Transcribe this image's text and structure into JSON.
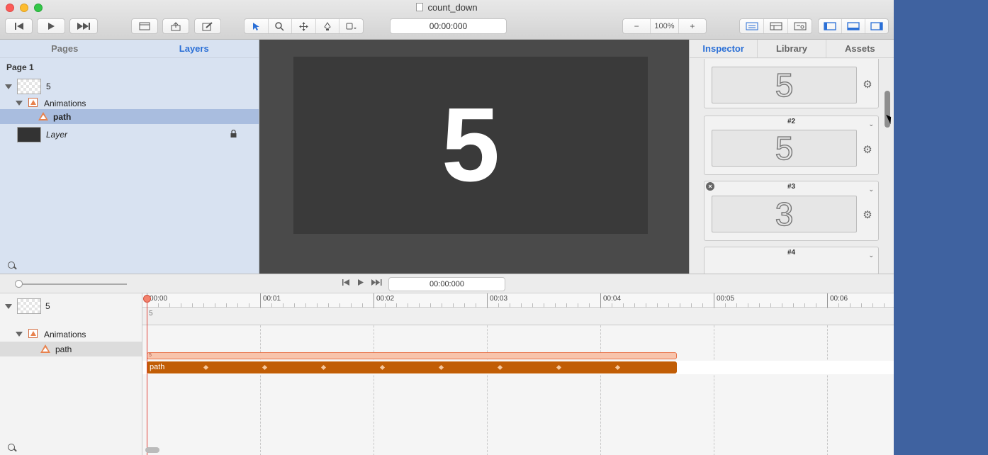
{
  "window": {
    "title": "count_down"
  },
  "toolbar": {
    "time": "00:00:000",
    "zoom": "100%",
    "zoom_minus": "−",
    "zoom_plus": "+"
  },
  "left_panel": {
    "tabs": [
      "Pages",
      "Layers"
    ],
    "active_tab": "Layers",
    "page_label": "Page 1",
    "layers": [
      {
        "name": "5",
        "level": 0
      },
      {
        "name": "Animations",
        "level": 1
      },
      {
        "name": "path",
        "level": 2,
        "selected": true
      },
      {
        "name": "Layer",
        "level": 0,
        "locked": true
      }
    ]
  },
  "canvas": {
    "display_number": "5",
    "artboard_color": "#3a3a3a"
  },
  "inspector": {
    "tabs": [
      "Inspector",
      "Library",
      "Assets"
    ],
    "active_tab": "Inspector",
    "keyframes": [
      {
        "label": "",
        "digit": "5"
      },
      {
        "label": "#2",
        "digit": "5"
      },
      {
        "label": "#3",
        "digit": "3"
      },
      {
        "label": "#4",
        "digit": ""
      }
    ]
  },
  "timeline": {
    "time": "00:00:000",
    "ruler_labels": [
      "00:00",
      "00:01",
      "00:02",
      "00:03",
      "00:04",
      "00:05",
      "00:06"
    ],
    "rows": [
      {
        "name": "5"
      },
      {
        "name": "Animations"
      },
      {
        "name": "path"
      }
    ],
    "track_5_label": "5",
    "animation_bar_label": "5",
    "path_bar_label": "path",
    "accent_color": "#c15d05"
  }
}
